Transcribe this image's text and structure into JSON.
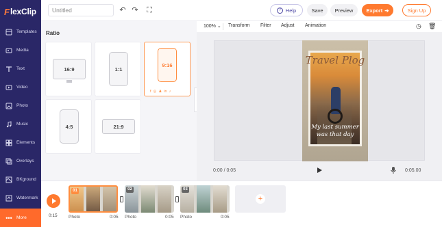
{
  "app": {
    "logo_mark": "F",
    "logo_text": "lexClip"
  },
  "sidebar": {
    "items": [
      {
        "label": "Templates",
        "icon": "templates-icon"
      },
      {
        "label": "Media",
        "icon": "media-icon"
      },
      {
        "label": "Text",
        "icon": "text-icon"
      },
      {
        "label": "Video",
        "icon": "video-icon"
      },
      {
        "label": "Photo",
        "icon": "photo-icon"
      },
      {
        "label": "Music",
        "icon": "music-icon"
      },
      {
        "label": "Elements",
        "icon": "elements-icon"
      },
      {
        "label": "Overlays",
        "icon": "overlays-icon"
      },
      {
        "label": "BKground",
        "icon": "background-icon"
      },
      {
        "label": "Watermark",
        "icon": "watermark-icon"
      },
      {
        "label": "More",
        "icon": "more-icon"
      }
    ]
  },
  "header": {
    "title_value": "Untitled",
    "help_label": "Help",
    "save_label": "Save",
    "preview_label": "Preview",
    "export_label": "Export",
    "signup_label": "Sign Up"
  },
  "panel": {
    "title": "Ratio",
    "ratios": [
      {
        "label": "16:9"
      },
      {
        "label": "1:1"
      },
      {
        "label": "9:16"
      },
      {
        "label": "4:5"
      },
      {
        "label": "21:9"
      }
    ],
    "selected": "9:16",
    "social_icons": [
      "f",
      "◎",
      "♟",
      "in",
      "♪"
    ]
  },
  "toolbar": {
    "zoom": "100%",
    "items": [
      "Transform",
      "Filter",
      "Adjust",
      "Animation"
    ]
  },
  "preview": {
    "title": "Travel Plog",
    "subtitle_line1": "My last summer",
    "subtitle_line2": "was that day",
    "time_current": "0:00 / 0:05",
    "time_total": "0:05.00"
  },
  "timeline": {
    "total_duration": "0:15",
    "clips": [
      {
        "num": "01",
        "name": "Photo",
        "duration": "0:05"
      },
      {
        "num": "02",
        "name": "Photo",
        "duration": "0:05"
      },
      {
        "num": "03",
        "name": "Photo",
        "duration": "0:05"
      }
    ],
    "add_symbol": "+"
  },
  "colors": {
    "accent": "#ff7a2f",
    "sidebar": "#2a2767",
    "help": "#4b46a3"
  }
}
